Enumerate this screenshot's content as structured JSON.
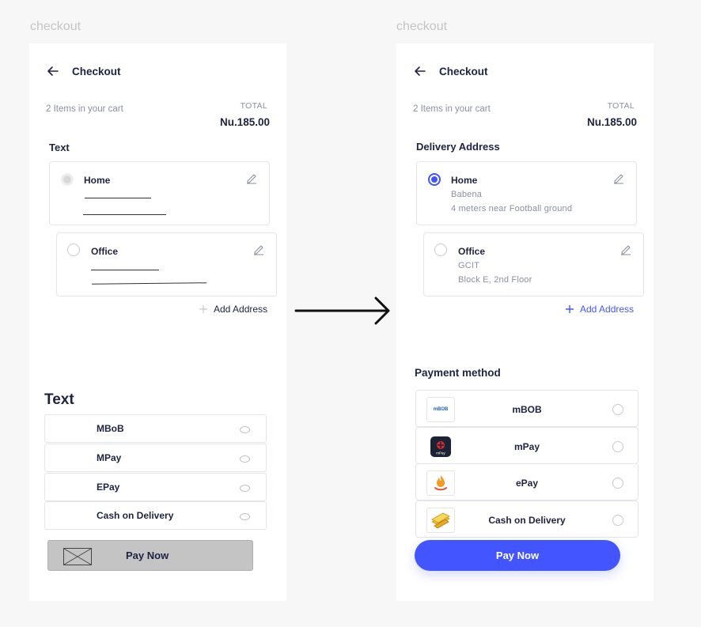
{
  "labels": {
    "wireframe": "checkout",
    "design": "checkout"
  },
  "colors": {
    "accent": "#4355ff",
    "text": "#1d2340",
    "muted": "#8a8fa3"
  },
  "wireframe": {
    "title": "Checkout",
    "cart_count": "2 Items in your cart",
    "total_label": "TOTAL",
    "total_value": "Nu.185.00",
    "address_heading": "Text",
    "addresses": [
      {
        "name": "Home"
      },
      {
        "name": "Office"
      }
    ],
    "add_address": "Add Address",
    "payment_heading": "Text",
    "payments": [
      "MBoB",
      "MPay",
      "EPay",
      "Cash on Delivery"
    ],
    "pay_now": "Pay Now"
  },
  "design": {
    "title": "Checkout",
    "cart_count": "2 Items in your cart",
    "total_label": "TOTAL",
    "total_value": "Nu.185.00",
    "address_heading": "Delivery Address",
    "addresses": [
      {
        "name": "Home",
        "line1": "Babena",
        "line2": "4 meters near  Football ground",
        "selected": true
      },
      {
        "name": "Office",
        "line1": "GCIT",
        "line2": "Block E, 2nd  Floor",
        "selected": false
      }
    ],
    "add_address": "Add Address",
    "payment_heading": "Payment method",
    "payments": [
      {
        "name": "mBOB",
        "logo_text": "mBOB"
      },
      {
        "name": "mPay",
        "logo_text": "mPay"
      },
      {
        "name": "ePay"
      },
      {
        "name": "Cash on Delivery"
      }
    ],
    "pay_now": "Pay Now"
  }
}
